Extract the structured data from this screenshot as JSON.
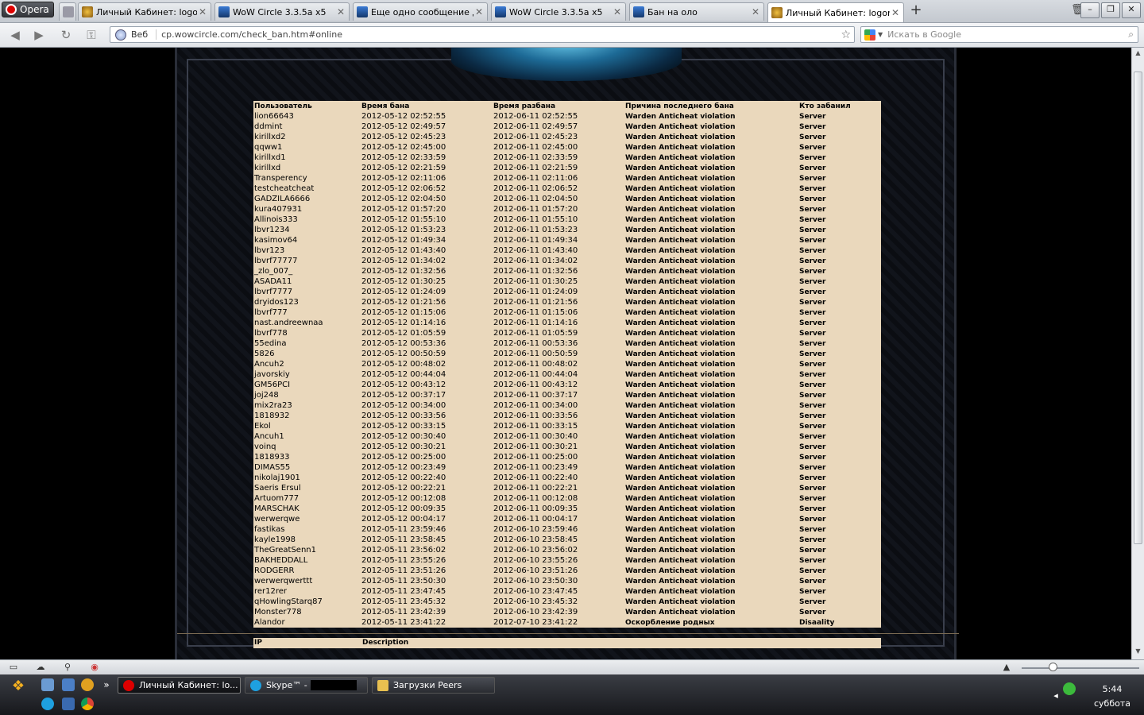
{
  "browser": {
    "menu_label": "Opera",
    "tabs": [
      {
        "title": "",
        "icon": "gen",
        "active": false
      },
      {
        "title": "Личный Кабинет: logon...",
        "icon": "wow",
        "active": false
      },
      {
        "title": "WoW Circle 3.3.5a x5",
        "icon": "wc",
        "active": false
      },
      {
        "title": "Еще одно сообщение д...",
        "icon": "wc",
        "active": false
      },
      {
        "title": "WoW Circle 3.3.5a x5",
        "icon": "wc",
        "active": false
      },
      {
        "title": "Бан на оло",
        "icon": "wc",
        "active": false
      },
      {
        "title": "Личный Кабинет: logon...",
        "icon": "wow",
        "active": true
      }
    ],
    "address": {
      "mode_label": "Веб",
      "url": "cp.wowcircle.com/check_ban.htm#online"
    },
    "search_placeholder": "Искать в Google"
  },
  "ban_table": {
    "headers": [
      "Пользователь",
      "Время бана",
      "Время разбана",
      "Причина последнего бана",
      "Кто забанил"
    ],
    "rows": [
      [
        "lion66643",
        "2012-05-12 02:52:55",
        "2012-06-11 02:52:55",
        "Warden Anticheat violation",
        "Server"
      ],
      [
        "ddmint",
        "2012-05-12 02:49:57",
        "2012-06-11 02:49:57",
        "Warden Anticheat violation",
        "Server"
      ],
      [
        "kirillxd2",
        "2012-05-12 02:45:23",
        "2012-06-11 02:45:23",
        "Warden Anticheat violation",
        "Server"
      ],
      [
        "qqww1",
        "2012-05-12 02:45:00",
        "2012-06-11 02:45:00",
        "Warden Anticheat violation",
        "Server"
      ],
      [
        "kirillxd1",
        "2012-05-12 02:33:59",
        "2012-06-11 02:33:59",
        "Warden Anticheat violation",
        "Server"
      ],
      [
        "kirillxd",
        "2012-05-12 02:21:59",
        "2012-06-11 02:21:59",
        "Warden Anticheat violation",
        "Server"
      ],
      [
        "Transperency",
        "2012-05-12 02:11:06",
        "2012-06-11 02:11:06",
        "Warden Anticheat violation",
        "Server"
      ],
      [
        "testcheatcheat",
        "2012-05-12 02:06:52",
        "2012-06-11 02:06:52",
        "Warden Anticheat violation",
        "Server"
      ],
      [
        "GADZILA6666",
        "2012-05-12 02:04:50",
        "2012-06-11 02:04:50",
        "Warden Anticheat violation",
        "Server"
      ],
      [
        "kura407931",
        "2012-05-12 01:57:20",
        "2012-06-11 01:57:20",
        "Warden Anticheat violation",
        "Server"
      ],
      [
        "Allinois333",
        "2012-05-12 01:55:10",
        "2012-06-11 01:55:10",
        "Warden Anticheat violation",
        "Server"
      ],
      [
        "lbvr1234",
        "2012-05-12 01:53:23",
        "2012-06-11 01:53:23",
        "Warden Anticheat violation",
        "Server"
      ],
      [
        "kasimov64",
        "2012-05-12 01:49:34",
        "2012-06-11 01:49:34",
        "Warden Anticheat violation",
        "Server"
      ],
      [
        "lbvr123",
        "2012-05-12 01:43:40",
        "2012-06-11 01:43:40",
        "Warden Anticheat violation",
        "Server"
      ],
      [
        "lbvrf77777",
        "2012-05-12 01:34:02",
        "2012-06-11 01:34:02",
        "Warden Anticheat violation",
        "Server"
      ],
      [
        "_zlo_007_",
        "2012-05-12 01:32:56",
        "2012-06-11 01:32:56",
        "Warden Anticheat violation",
        "Server"
      ],
      [
        "ASADA11",
        "2012-05-12 01:30:25",
        "2012-06-11 01:30:25",
        "Warden Anticheat violation",
        "Server"
      ],
      [
        "lbvrf7777",
        "2012-05-12 01:24:09",
        "2012-06-11 01:24:09",
        "Warden Anticheat violation",
        "Server"
      ],
      [
        "dryidos123",
        "2012-05-12 01:21:56",
        "2012-06-11 01:21:56",
        "Warden Anticheat violation",
        "Server"
      ],
      [
        "lbvrf777",
        "2012-05-12 01:15:06",
        "2012-06-11 01:15:06",
        "Warden Anticheat violation",
        "Server"
      ],
      [
        "nast.andreewnaa",
        "2012-05-12 01:14:16",
        "2012-06-11 01:14:16",
        "Warden Anticheat violation",
        "Server"
      ],
      [
        "lbvrf778",
        "2012-05-12 01:05:59",
        "2012-06-11 01:05:59",
        "Warden Anticheat violation",
        "Server"
      ],
      [
        "55edina",
        "2012-05-12 00:53:36",
        "2012-06-11 00:53:36",
        "Warden Anticheat violation",
        "Server"
      ],
      [
        "5826",
        "2012-05-12 00:50:59",
        "2012-06-11 00:50:59",
        "Warden Anticheat violation",
        "Server"
      ],
      [
        "Ancuh2",
        "2012-05-12 00:48:02",
        "2012-06-11 00:48:02",
        "Warden Anticheat violation",
        "Server"
      ],
      [
        "javorskiy",
        "2012-05-12 00:44:04",
        "2012-06-11 00:44:04",
        "Warden Anticheat violation",
        "Server"
      ],
      [
        "GM56PCI",
        "2012-05-12 00:43:12",
        "2012-06-11 00:43:12",
        "Warden Anticheat violation",
        "Server"
      ],
      [
        "joj248",
        "2012-05-12 00:37:17",
        "2012-06-11 00:37:17",
        "Warden Anticheat violation",
        "Server"
      ],
      [
        "mix2ra23",
        "2012-05-12 00:34:00",
        "2012-06-11 00:34:00",
        "Warden Anticheat violation",
        "Server"
      ],
      [
        "1818932",
        "2012-05-12 00:33:56",
        "2012-06-11 00:33:56",
        "Warden Anticheat violation",
        "Server"
      ],
      [
        "Ekol",
        "2012-05-12 00:33:15",
        "2012-06-11 00:33:15",
        "Warden Anticheat violation",
        "Server"
      ],
      [
        "Ancuh1",
        "2012-05-12 00:30:40",
        "2012-06-11 00:30:40",
        "Warden Anticheat violation",
        "Server"
      ],
      [
        "voinq",
        "2012-05-12 00:30:21",
        "2012-06-11 00:30:21",
        "Warden Anticheat violation",
        "Server"
      ],
      [
        "1818933",
        "2012-05-12 00:25:00",
        "2012-06-11 00:25:00",
        "Warden Anticheat violation",
        "Server"
      ],
      [
        "DIMAS55",
        "2012-05-12 00:23:49",
        "2012-06-11 00:23:49",
        "Warden Anticheat violation",
        "Server"
      ],
      [
        "nikolaj1901",
        "2012-05-12 00:22:40",
        "2012-06-11 00:22:40",
        "Warden Anticheat violation",
        "Server"
      ],
      [
        "Saeris Ersul",
        "2012-05-12 00:22:21",
        "2012-06-11 00:22:21",
        "Warden Anticheat violation",
        "Server"
      ],
      [
        "Artuom777",
        "2012-05-12 00:12:08",
        "2012-06-11 00:12:08",
        "Warden Anticheat violation",
        "Server"
      ],
      [
        "MARSCHAK",
        "2012-05-12 00:09:35",
        "2012-06-11 00:09:35",
        "Warden Anticheat violation",
        "Server"
      ],
      [
        "werwerqwe",
        "2012-05-12 00:04:17",
        "2012-06-11 00:04:17",
        "Warden Anticheat violation",
        "Server"
      ],
      [
        "fastikas",
        "2012-05-11 23:59:46",
        "2012-06-10 23:59:46",
        "Warden Anticheat violation",
        "Server"
      ],
      [
        "kayle1998",
        "2012-05-11 23:58:45",
        "2012-06-10 23:58:45",
        "Warden Anticheat violation",
        "Server"
      ],
      [
        "TheGreatSenn1",
        "2012-05-11 23:56:02",
        "2012-06-10 23:56:02",
        "Warden Anticheat violation",
        "Server"
      ],
      [
        "BAKHEDDALL",
        "2012-05-11 23:55:26",
        "2012-06-10 23:55:26",
        "Warden Anticheat violation",
        "Server"
      ],
      [
        "RODGERR",
        "2012-05-11 23:51:26",
        "2012-06-10 23:51:26",
        "Warden Anticheat violation",
        "Server"
      ],
      [
        "werwerqwerttt",
        "2012-05-11 23:50:30",
        "2012-06-10 23:50:30",
        "Warden Anticheat violation",
        "Server"
      ],
      [
        "rer12rer",
        "2012-05-11 23:47:45",
        "2012-06-10 23:47:45",
        "Warden Anticheat violation",
        "Server"
      ],
      [
        "qHowlingStarq87",
        "2012-05-11 23:45:32",
        "2012-06-10 23:45:32",
        "Warden Anticheat violation",
        "Server"
      ],
      [
        "Monster778",
        "2012-05-11 23:42:39",
        "2012-06-10 23:42:39",
        "Warden Anticheat violation",
        "Server"
      ],
      [
        "Alandor",
        "2012-05-11 23:41:22",
        "2012-07-10 23:41:22",
        "Оскорбление родных",
        "Disaality"
      ]
    ]
  },
  "ip_table": {
    "headers": [
      "IP",
      "Description"
    ]
  },
  "taskbar": {
    "tasks": [
      {
        "label": "Личный Кабинет: lo...",
        "icon": "opera",
        "active": true
      },
      {
        "label": "Skype™ -",
        "icon": "skype",
        "active": false
      },
      {
        "label": "Загрузки Peers",
        "icon": "folder",
        "active": false
      }
    ],
    "clock_time": "5:44",
    "clock_day": "суббота"
  },
  "colors": {
    "table_bg": "#ead8bc",
    "page_bg": "#000000"
  }
}
